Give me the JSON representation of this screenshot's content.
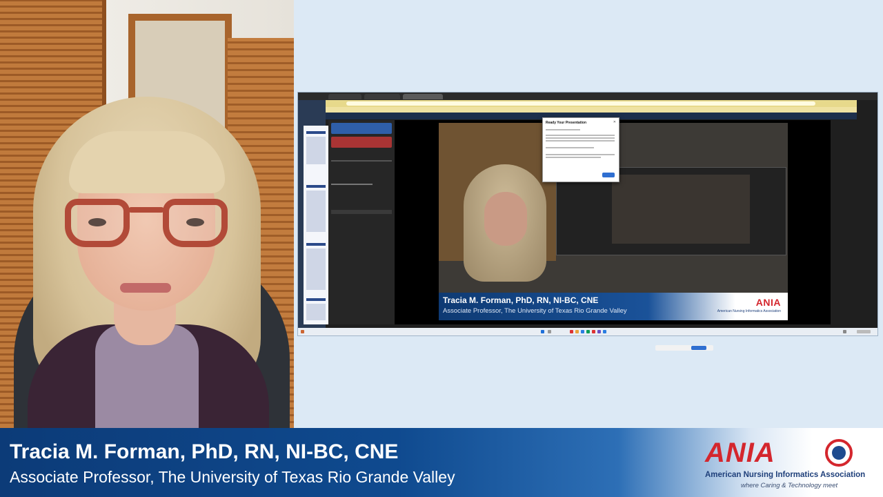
{
  "presenter": {
    "name": "Tracia M. Forman, PhD, RN, NI-BC, CNE",
    "title": "Associate Professor, The University of Texas Rio Grande Valley"
  },
  "logo": {
    "wordmark": "ANIA",
    "organization": "American Nursing Informatics Association",
    "tagline": "where Caring & Technology meet",
    "brand_red": "#d4262d",
    "brand_blue": "#1e3f7a"
  },
  "shared_screen": {
    "dialog": {
      "title": "Ready Your Presentation",
      "close_icon": "close-icon"
    },
    "recording_panel": {
      "finish_color": "#2f5fa9",
      "cancel_color": "#a93434"
    },
    "mini_lower_third": {
      "name": "Tracia M. Forman, PhD, RN, NI-BC, CNE",
      "title": "Associate Professor, The University of Texas Rio Grande Valley",
      "logo": "ANIA",
      "organization": "American Nursing Informatics Association"
    }
  },
  "colors": {
    "banner_dark": "#0c3b78",
    "background": "#dce9f5"
  }
}
